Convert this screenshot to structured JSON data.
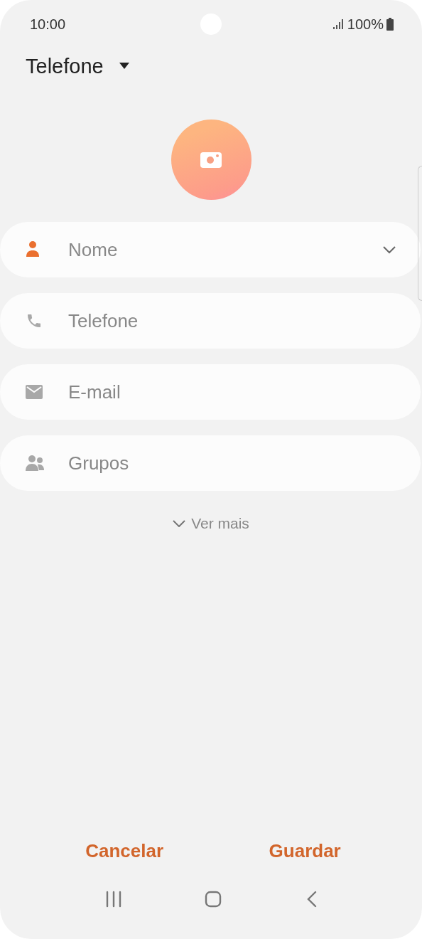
{
  "status_bar": {
    "time": "10:00",
    "battery": "100%"
  },
  "header": {
    "title": "Telefone"
  },
  "fields": [
    {
      "kind": "name",
      "placeholder": "Nome",
      "active": true,
      "expandable": true
    },
    {
      "kind": "phone",
      "placeholder": "Telefone",
      "active": false,
      "expandable": false
    },
    {
      "kind": "email",
      "placeholder": "E-mail",
      "active": false,
      "expandable": false
    },
    {
      "kind": "groups",
      "placeholder": "Grupos",
      "active": false,
      "expandable": false
    }
  ],
  "more_link": "Ver mais",
  "buttons": [
    "Cancelar",
    "Guardar"
  ]
}
